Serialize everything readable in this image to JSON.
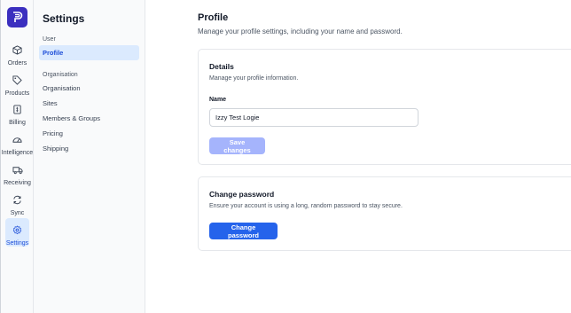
{
  "rail": {
    "items": [
      {
        "label": "Orders",
        "icon": "box-icon"
      },
      {
        "label": "Products",
        "icon": "tag-icon"
      },
      {
        "label": "Billing",
        "icon": "receipt-icon"
      },
      {
        "label": "Intelligence",
        "icon": "chart-icon"
      },
      {
        "label": "Receiving",
        "icon": "truck-icon"
      },
      {
        "label": "Sync",
        "icon": "sync-icon"
      },
      {
        "label": "Settings",
        "icon": "gear-icon",
        "active": true
      }
    ]
  },
  "sidebar": {
    "title": "Settings",
    "group_user": "User",
    "profile": "Profile",
    "group_org": "Organisation",
    "items": [
      "Organisation",
      "Sites",
      "Members & Groups",
      "Pricing",
      "Shipping"
    ]
  },
  "main": {
    "title": "Profile",
    "subtitle": "Manage your profile settings, including your name and password.",
    "details": {
      "title": "Details",
      "subtitle": "Manage your profile information.",
      "name_label": "Name",
      "name_value": "Izzy Test Logie",
      "save_label": "Save changes"
    },
    "password": {
      "title": "Change password",
      "subtitle": "Ensure your account is using a long, random password to stay secure.",
      "button_label": "Change password"
    }
  },
  "colors": {
    "accent": "#2563eb",
    "logo": "#3b2fbf",
    "active_bg": "#dbeafe",
    "disabled_button": "#a5b4fc"
  }
}
